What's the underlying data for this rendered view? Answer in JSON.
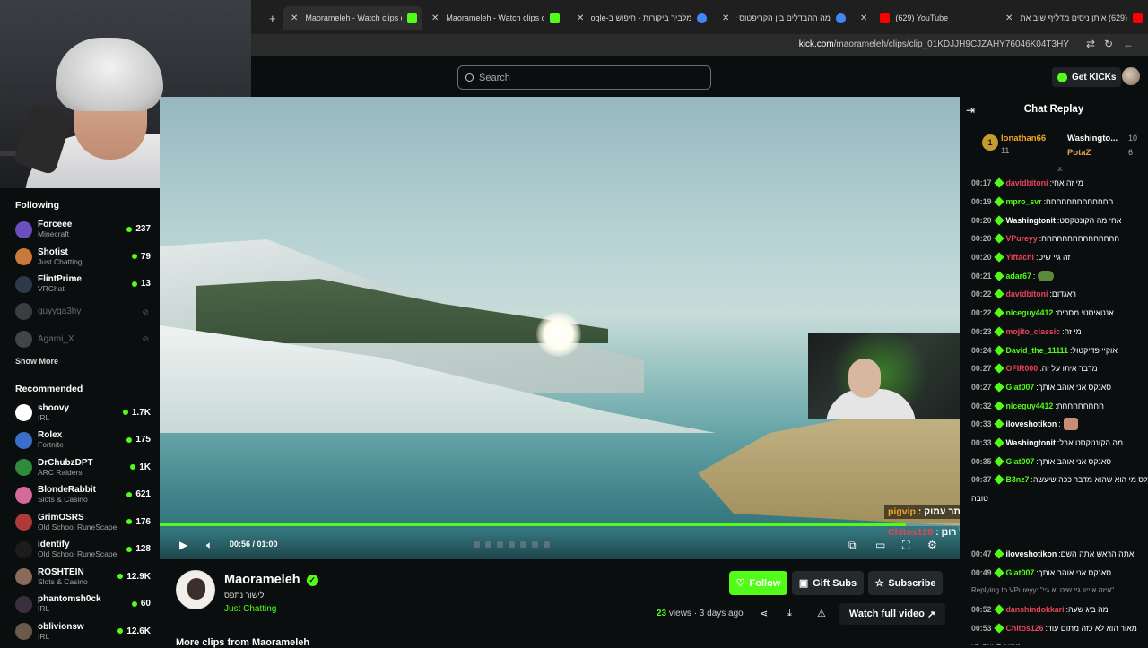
{
  "browser": {
    "tabs": [
      {
        "label": "Maorameleh - Watch clips on K",
        "active": true,
        "favicon_color": "#53fc18"
      },
      {
        "label": "Maorameleh - Watch clips on K",
        "active": false,
        "favicon_color": "#53fc18"
      },
      {
        "label": "מלביר ביקורות - חיפוש ב-Google",
        "active": false,
        "favicon_color": "#4285f4"
      },
      {
        "label": "מה ההבדלים בין הקריפטוס לגונ",
        "active": false,
        "favicon_color": "#4285f4"
      },
      {
        "label": "(629) YouTube",
        "active": false,
        "favicon_color": "#ff0000"
      },
      {
        "label": "(629) איתן ניסים מדליף שוב את",
        "active": false,
        "favicon_color": "#ff0000"
      }
    ],
    "new_tab": "+",
    "url_domain": "kick.com",
    "url_path": "/maorameleh/clips/clip_01KDJJH9CJZAHY76046K04T3HY"
  },
  "topbar": {
    "search_placeholder": "Search",
    "get_kicks_label": "Get KICKs"
  },
  "sidebar": {
    "following_heading": "Following",
    "following": [
      {
        "name": "Forceee",
        "category": "Minecraft",
        "viewers": "237",
        "live": true,
        "avatar_color": "#6b4fbf"
      },
      {
        "name": "Shotist",
        "category": "Just Chatting",
        "viewers": "79",
        "live": true,
        "avatar_color": "#c9793a"
      },
      {
        "name": "FlintPrime",
        "category": "VRChat",
        "viewers": "13",
        "live": true,
        "avatar_color": "#2c3a4a"
      },
      {
        "name": "guyyga3hy",
        "category": "",
        "viewers": "",
        "live": false,
        "avatar_color": "#777777"
      },
      {
        "name": "Agami_X",
        "category": "",
        "viewers": "",
        "live": false,
        "avatar_color": "#888888"
      }
    ],
    "show_more": "Show More",
    "recommended_heading": "Recommended",
    "recommended": [
      {
        "name": "shoovy",
        "category": "IRL",
        "viewers": "1.7K",
        "avatar_color": "#ffffff"
      },
      {
        "name": "Rolex",
        "category": "Fortnite",
        "viewers": "175",
        "avatar_color": "#3a6fc9"
      },
      {
        "name": "DrChubzDPT",
        "category": "ARC Raiders",
        "viewers": "1K",
        "avatar_color": "#2f8a3a"
      },
      {
        "name": "BlondeRabbit",
        "category": "Slots & Casino",
        "viewers": "621",
        "avatar_color": "#d46a9a"
      },
      {
        "name": "GrimOSRS",
        "category": "Old School RuneScape",
        "viewers": "176",
        "avatar_color": "#b03a3a"
      },
      {
        "name": "identify",
        "category": "Old School RuneScape",
        "viewers": "128",
        "avatar_color": "#1c1c1c"
      },
      {
        "name": "ROSHTEIN",
        "category": "Slots & Casino",
        "viewers": "12.9K",
        "avatar_color": "#8a6a5a"
      },
      {
        "name": "phantomsh0ck",
        "category": "IRL",
        "viewers": "60",
        "avatar_color": "#3a2f3a"
      },
      {
        "name": "oblivionsw",
        "category": "IRL",
        "viewers": "12.6K",
        "avatar_color": "#6a5a4a"
      }
    ]
  },
  "player": {
    "timecode": "00:56 / 01:00",
    "progress": 0.933,
    "overlay_messages": [
      {
        "user": "pigvip",
        "text": "האכל לו יותר עמוק",
        "user_color": "#f5a623"
      },
      {
        "user": "Chitos126",
        "text": "אבל אתה מוצץ של רונן",
        "user_color": "#e8455a"
      }
    ]
  },
  "streamer": {
    "name": "Maorameleh",
    "subtitle": "לישור נתפס",
    "category": "Just Chatting",
    "more_clips": "More clips from Maorameleh"
  },
  "actions": {
    "follow": "Follow",
    "gift_subs": "Gift Subs",
    "subscribe": "Subscribe",
    "views_count": "23",
    "views_label": "views",
    "posted": "· 3 days ago",
    "watch_full": "Watch full video"
  },
  "chat": {
    "title": "Chat Replay",
    "pinned": {
      "rank": "1",
      "user1": "lonathan66",
      "user1_count": "11",
      "user2": "Washingto...",
      "user2_count": "10",
      "user3": "PotaZ",
      "user3_count": "6"
    },
    "messages": [
      {
        "time": "00:17",
        "user": "davidbitoni",
        "text": "מי זה אחי",
        "color": "#e8455a"
      },
      {
        "time": "00:19",
        "user": "mpro_svr",
        "text": "חחחחחחחחחחחחח",
        "color": "#53fc18"
      },
      {
        "time": "00:20",
        "user": "Washingtonit",
        "text": "אחי מה הקונטקסט",
        "color": "#ffffff"
      },
      {
        "time": "00:20",
        "user": "VPureyy",
        "text": "חחחחחחחחחחחחחחח",
        "color": "#e8455a"
      },
      {
        "time": "00:20",
        "user": "Yiftachi",
        "text": "זה גיי שיט",
        "color": "#e8455a"
      },
      {
        "time": "00:21",
        "user": "adar67",
        "text": "",
        "color": "#53fc18",
        "emote": true
      },
      {
        "time": "00:22",
        "user": "davidbitoni",
        "text": "ראגדום",
        "color": "#e8455a"
      },
      {
        "time": "00:22",
        "user": "niceguy4412",
        "text": "אנטאיסטי מסריח",
        "color": "#53fc18"
      },
      {
        "time": "00:23",
        "user": "mojito_classic",
        "text": "מי זה",
        "color": "#e8455a"
      },
      {
        "time": "00:24",
        "user": "David_the_11111",
        "text": "אוקיי פדיקטול",
        "color": "#53fc18"
      },
      {
        "time": "00:27",
        "user": "OFIR000",
        "text": "מדבר איתו על זה",
        "color": "#e8455a"
      },
      {
        "time": "00:27",
        "user": "Giat007",
        "text": "סאנקס אני אוהב אותך",
        "color": "#53fc18"
      },
      {
        "time": "00:32",
        "user": "niceguy4412",
        "text": "חחחחחחחחח",
        "color": "#53fc18"
      },
      {
        "time": "00:33",
        "user": "iloveshotikon",
        "text": "",
        "color": "#ffffff",
        "emote": true
      },
      {
        "time": "00:33",
        "user": "Washingtonit",
        "text": "מה הקונטקסט אבל",
        "color": "#ffffff"
      },
      {
        "time": "00:35",
        "user": "Giat007",
        "text": "סאנקס אני אוהב אותך",
        "color": "#53fc18"
      },
      {
        "time": "00:37",
        "user": "B3nz7",
        "text": "בתכלס מי הוא שהוא מדבר ככה שיעשה",
        "color": "#53fc18"
      },
      {
        "time": "",
        "user": "",
        "text": "טובה",
        "color": "#ffffff"
      },
      {
        "time": "",
        "user": "",
        "text": "",
        "color": "#ffffff"
      },
      {
        "time": "",
        "user": "",
        "text": "",
        "color": "#ffffff"
      },
      {
        "time": "00:47",
        "user": "iloveshotikon",
        "text": "אתה הראש אתה השם",
        "color": "#ffffff"
      },
      {
        "time": "00:49",
        "user": "Giat007",
        "text": "סאנקס אני אוהב אותך",
        "color": "#53fc18"
      },
      {
        "time": "",
        "user": "",
        "text": "Replying to VPureyy: \"איזה איייוו גיי שיט יא גיי\"",
        "color": "#999999",
        "reply": true
      },
      {
        "time": "00:52",
        "user": "danshindokkari",
        "text": "מה ביג שעה",
        "color": "#e8455a"
      },
      {
        "time": "00:53",
        "user": "Chitos126",
        "text": "מאור הוא לא כזה מתום עוד",
        "color": "#e8455a"
      },
      {
        "time": "",
        "user": "",
        "text": "מביא לו שם רע",
        "color": "#ffffff"
      }
    ]
  }
}
